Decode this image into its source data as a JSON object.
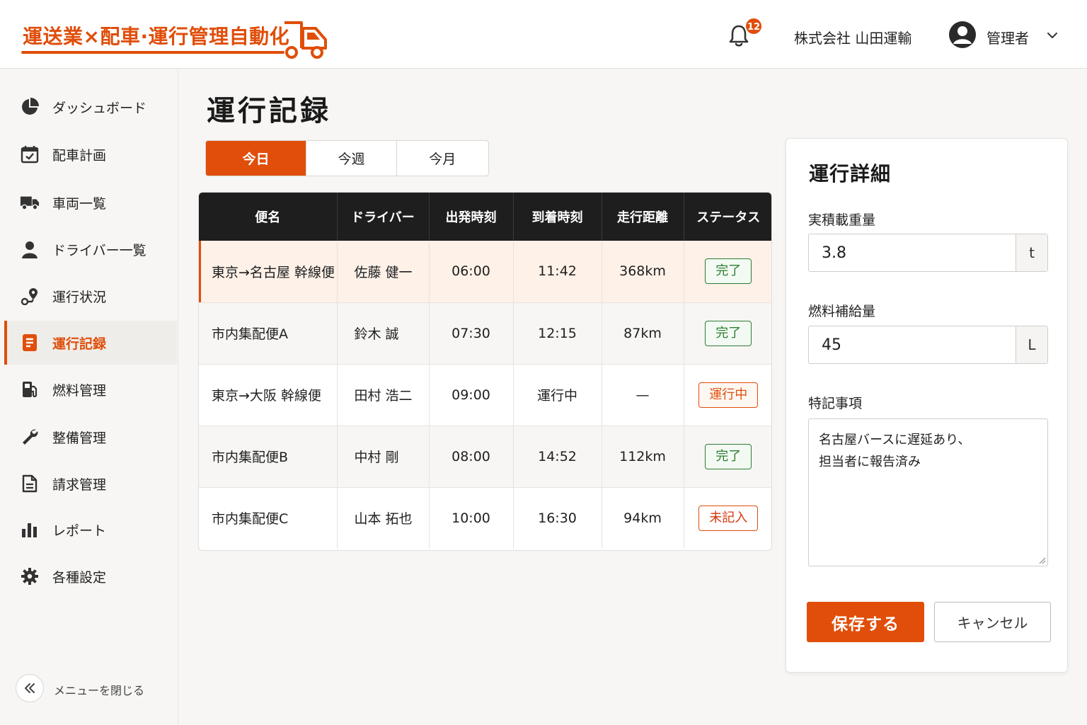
{
  "app": {
    "title": "運送業×配車·運行管理自動化",
    "notification_count": "12",
    "company": "株式会社 山田運輸",
    "user_role": "管理者",
    "accent_color": "#e04e0a"
  },
  "sidebar": {
    "items": [
      {
        "label": "ダッシュボード",
        "icon": "pie-chart-icon"
      },
      {
        "label": "配車計画",
        "icon": "calendar-icon"
      },
      {
        "label": "車両一覧",
        "icon": "truck-icon"
      },
      {
        "label": "ドライバー一覧",
        "icon": "person-icon"
      },
      {
        "label": "運行状況",
        "icon": "route-pin-icon"
      },
      {
        "label": "運行記録",
        "icon": "document-icon"
      },
      {
        "label": "燃料管理",
        "icon": "fuel-pump-icon"
      },
      {
        "label": "整備管理",
        "icon": "wrench-icon"
      },
      {
        "label": "請求管理",
        "icon": "invoice-icon"
      },
      {
        "label": "レポート",
        "icon": "bar-chart-icon"
      },
      {
        "label": "各種設定",
        "icon": "gear-icon"
      }
    ],
    "active_index": 5,
    "collapse_label": "メニューを閉じる"
  },
  "main": {
    "title": "運行記録",
    "tabs": [
      {
        "label": "今日"
      },
      {
        "label": "今週"
      },
      {
        "label": "今月"
      }
    ],
    "active_tab": 0,
    "table": {
      "columns": [
        "便名",
        "ドライバー",
        "出発時刻",
        "到着時刻",
        "走行距離",
        "ステータス"
      ],
      "rows": [
        {
          "route": "東京→名古屋 幹線便",
          "driver": "佐藤 健一",
          "depart": "06:00",
          "arrive": "11:42",
          "distance": "368km",
          "status": "完了"
        },
        {
          "route": "市内集配便A",
          "driver": "鈴木 誠",
          "depart": "07:30",
          "arrive": "12:15",
          "distance": "87km",
          "status": "完了"
        },
        {
          "route": "東京→大阪 幹線便",
          "driver": "田村 浩二",
          "depart": "09:00",
          "arrive": "運行中",
          "distance": "—",
          "status": "運行中"
        },
        {
          "route": "市内集配便B",
          "driver": "中村 剛",
          "depart": "08:00",
          "arrive": "14:52",
          "distance": "112km",
          "status": "完了"
        },
        {
          "route": "市内集配便C",
          "driver": "山本 拓也",
          "depart": "10:00",
          "arrive": "16:30",
          "distance": "94km",
          "status": "未記入"
        }
      ]
    }
  },
  "detail": {
    "title": "運行詳細",
    "load_label": "実積載重量",
    "load_value": "3.8",
    "load_unit": "t",
    "fuel_label": "燃料補給量",
    "fuel_value": "45",
    "fuel_unit": "L",
    "notes_label": "特記事項",
    "notes_value": "名古屋バースに遅延あり、\n担当者に報告済み",
    "save_label": "保存する",
    "cancel_label": "キャンセル"
  }
}
